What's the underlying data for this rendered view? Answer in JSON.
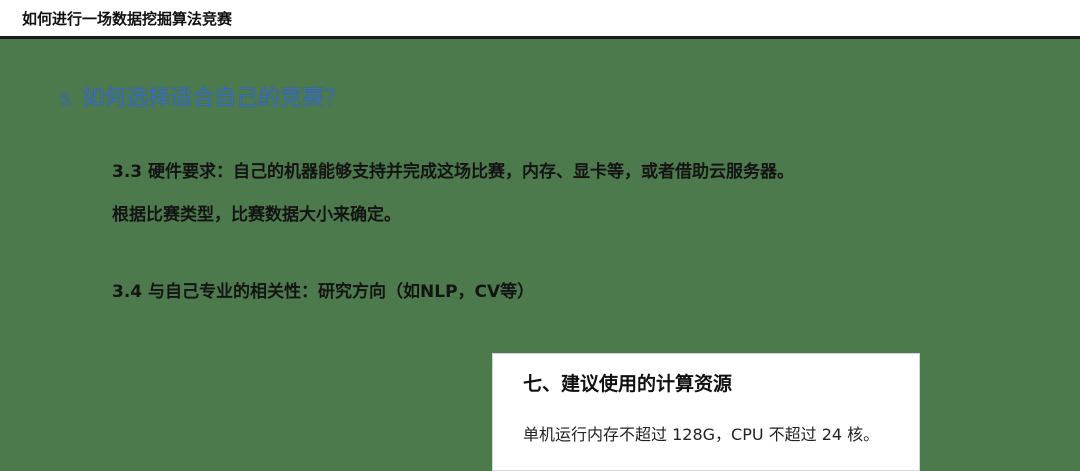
{
  "header": {
    "title": "如何进行一场数据挖掘算法竞赛"
  },
  "section": {
    "number": "5.",
    "heading": "如何选择适合自己的竞赛？"
  },
  "items": [
    "3.3 硬件要求：自己的机器能够支持并完成这场比赛，内存、显卡等，或者借助云服务器。",
    "根据比赛类型，比赛数据大小来确定。",
    "3.4 与自己专业的相关性：研究方向（如NLP，CV等）"
  ],
  "card": {
    "title": "七、建议使用的计算资源",
    "text": "单机运行内存不超过 128G，CPU 不超过 24 核。"
  }
}
